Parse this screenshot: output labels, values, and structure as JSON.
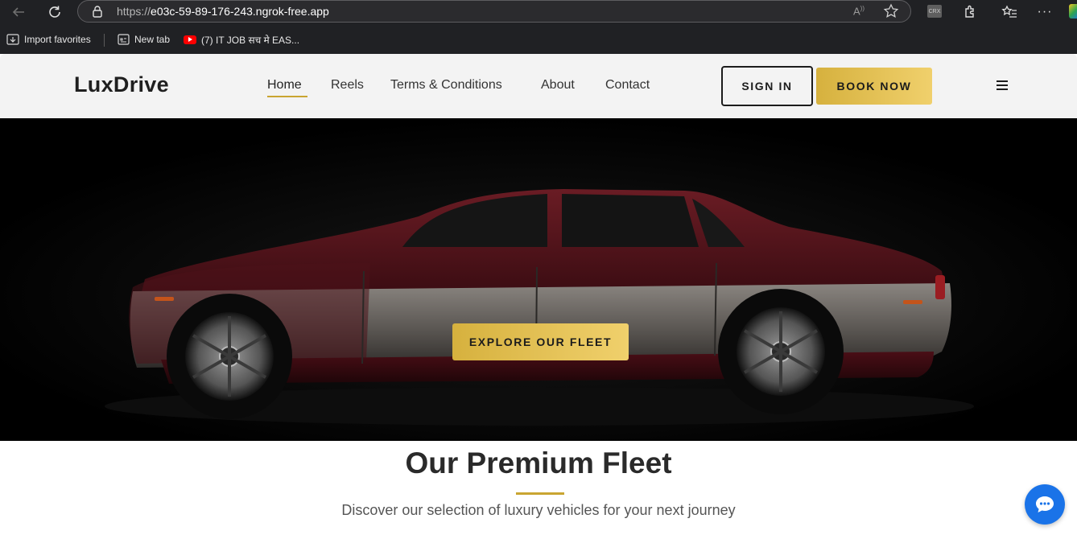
{
  "browser": {
    "url_scheme": "https://",
    "url_host": "e03c-59-89-176-243.ngrok-free.app",
    "crx_label": "CRX",
    "bookmarks": [
      {
        "label": "Import favorites",
        "icon": "import-icon"
      },
      {
        "label": "New tab",
        "icon": "new-tab-icon"
      },
      {
        "label": "(7) IT JOB सच मे EAS...",
        "icon": "youtube-icon"
      }
    ]
  },
  "header": {
    "logo": "LuxDrive",
    "nav": [
      {
        "label": "Home",
        "active": true
      },
      {
        "label": "Reels",
        "active": false
      },
      {
        "label": "Terms & Conditions",
        "active": false
      },
      {
        "label": "About",
        "active": false
      },
      {
        "label": "Contact",
        "active": false
      }
    ],
    "sign_in": "SIGN IN",
    "book_now": "BOOK NOW",
    "menu_icon": "hamburger-icon"
  },
  "hero": {
    "cta": "EXPLORE OUR FLEET"
  },
  "fleet": {
    "title": "Our Premium Fleet",
    "subtitle": "Discover our selection of luxury vehicles for your next journey"
  },
  "colors": {
    "accent_gold": "#d6b13e",
    "chat_blue": "#1a73e8"
  }
}
